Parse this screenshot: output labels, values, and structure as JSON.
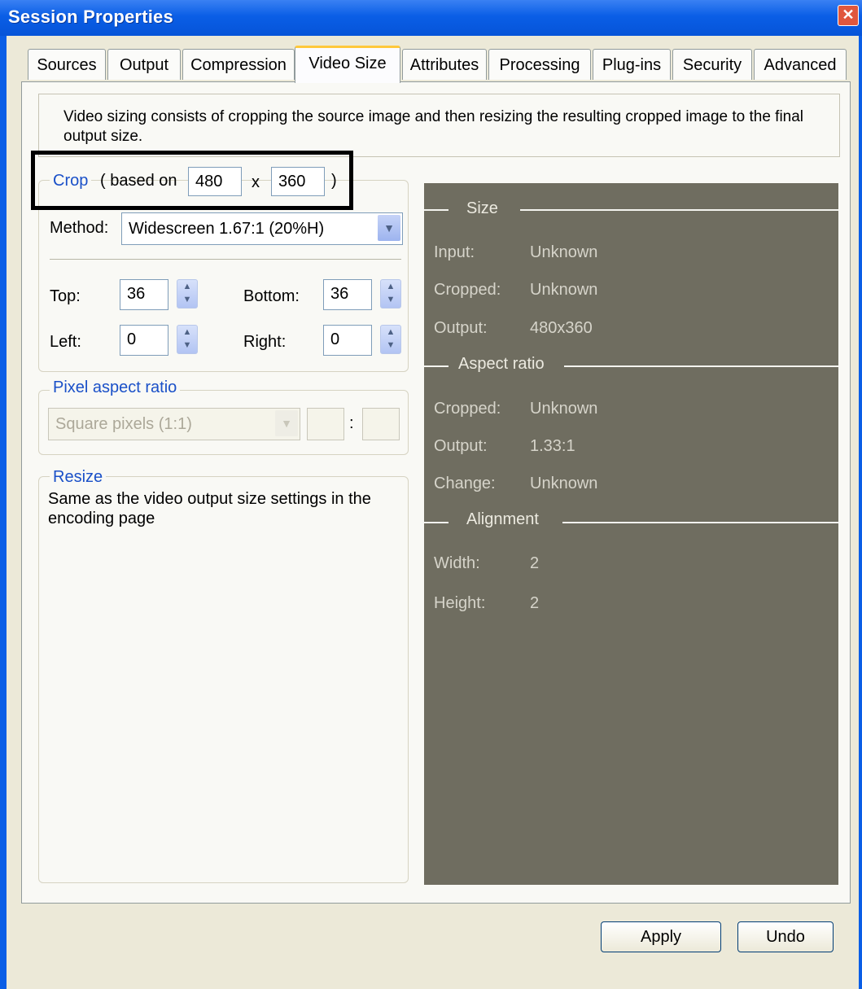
{
  "window": {
    "title": "Session Properties",
    "close_label": "✕"
  },
  "tabs": [
    {
      "label": "Sources"
    },
    {
      "label": "Output"
    },
    {
      "label": "Compression"
    },
    {
      "label": "Video Size",
      "active": true
    },
    {
      "label": "Attributes"
    },
    {
      "label": "Processing"
    },
    {
      "label": "Plug-ins"
    },
    {
      "label": "Security"
    },
    {
      "label": "Advanced"
    }
  ],
  "description": "Video sizing consists of cropping the source image and then resizing the resulting cropped image to the final output size.",
  "crop": {
    "legend": "Crop",
    "based_on_label": "( based on",
    "width": "480",
    "x_label": "x",
    "height": "360",
    "close_paren": ")",
    "method_label": "Method:",
    "method_value": "Widescreen 1.67:1 (20%H)",
    "top_label": "Top:",
    "top_value": "36",
    "bottom_label": "Bottom:",
    "bottom_value": "36",
    "left_label": "Left:",
    "left_value": "0",
    "right_label": "Right:",
    "right_value": "0"
  },
  "pixel_aspect": {
    "legend": "Pixel aspect ratio",
    "value": "Square pixels (1:1)",
    "separator": ":"
  },
  "resize": {
    "legend": "Resize",
    "text": "Same as the video output size settings in the encoding page"
  },
  "info": {
    "size_title": "Size",
    "input_label": "Input:",
    "input_value": "Unknown",
    "cropped_label": "Cropped:",
    "cropped_value": "Unknown",
    "output_label": "Output:",
    "output_value": "480x360",
    "aspect_title": "Aspect ratio",
    "ar_cropped_label": "Cropped:",
    "ar_cropped_value": "Unknown",
    "ar_output_label": "Output:",
    "ar_output_value": "1.33:1",
    "change_label": "Change:",
    "change_value": "Unknown",
    "alignment_title": "Alignment",
    "width_label": "Width:",
    "width_value": "2",
    "height_label": "Height:",
    "height_value": "2"
  },
  "buttons": {
    "apply": "Apply",
    "undo": "Undo"
  },
  "colors": {
    "panel": "#6f6d60",
    "legend": "#1a50c8",
    "title_bar": "#0a5ee6"
  }
}
